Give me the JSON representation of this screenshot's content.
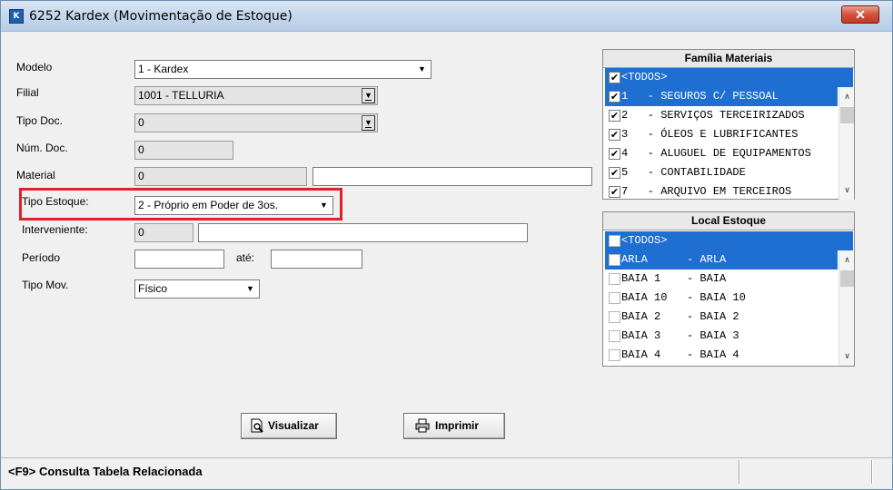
{
  "window": {
    "title": "6252 Kardex (Movimentação de Estoque)",
    "app_icon_text": "K",
    "close_glyph": "✕"
  },
  "form": {
    "modelo": {
      "label": "Modelo",
      "value": "1 - Kardex"
    },
    "filial": {
      "label": "Filial",
      "value": "1001 - TELLURIA"
    },
    "tipo_doc": {
      "label": "Tipo Doc.",
      "value": "0"
    },
    "num_doc": {
      "label": "Núm. Doc.",
      "value": "0"
    },
    "material": {
      "label": "Material",
      "value": "0",
      "description": ""
    },
    "tipo_estoque": {
      "label": "Tipo Estoque:",
      "value": "2 - Próprio em Poder de 3os."
    },
    "interveniente": {
      "label": "Interveniente:",
      "value": "0",
      "description": ""
    },
    "periodo": {
      "label": "Período",
      "from": "",
      "ate_label": "até:",
      "to": ""
    },
    "tipo_mov": {
      "label": "Tipo Mov.",
      "value": "Físico"
    }
  },
  "familia_panel": {
    "title": "Família Materiais",
    "rows": [
      {
        "text": "<TODOS>",
        "checked": true,
        "selected": true
      },
      {
        "text": "1   - SEGUROS C/ PESSOAL",
        "checked": true,
        "selected": true
      },
      {
        "text": "2   - SERVIÇOS TERCEIRIZADOS",
        "checked": true,
        "selected": false
      },
      {
        "text": "3   - ÓLEOS E LUBRIFICANTES",
        "checked": true,
        "selected": false
      },
      {
        "text": "4   - ALUGUEL DE EQUIPAMENTOS",
        "checked": true,
        "selected": false
      },
      {
        "text": "5   - CONTABILIDADE",
        "checked": true,
        "selected": false
      },
      {
        "text": "7   - ARQUIVO EM TERCEIROS",
        "checked": true,
        "selected": false
      }
    ]
  },
  "local_panel": {
    "title": "Local Estoque",
    "rows": [
      {
        "text": "<TODOS>",
        "checked": false,
        "selected": true
      },
      {
        "text": "ARLA      - ARLA",
        "checked": false,
        "selected": true
      },
      {
        "text": "BAIA 1    - BAIA",
        "checked": false,
        "selected": false
      },
      {
        "text": "BAIA 10   - BAIA 10",
        "checked": false,
        "selected": false
      },
      {
        "text": "BAIA 2    - BAIA 2",
        "checked": false,
        "selected": false
      },
      {
        "text": "BAIA 3    - BAIA 3",
        "checked": false,
        "selected": false
      },
      {
        "text": "BAIA 4    - BAIA 4",
        "checked": false,
        "selected": false
      }
    ]
  },
  "buttons": {
    "visualizar": "Visualizar",
    "imprimir": "Imprimir"
  },
  "statusbar": {
    "text": "<F9> Consulta Tabela Relacionada"
  },
  "icons": {
    "dropdown": "▼",
    "scroll_up": "∧",
    "scroll_down": "∨",
    "check": "✔"
  },
  "colors": {
    "selection": "#1e6fd1",
    "highlight_border": "#e0202a"
  }
}
